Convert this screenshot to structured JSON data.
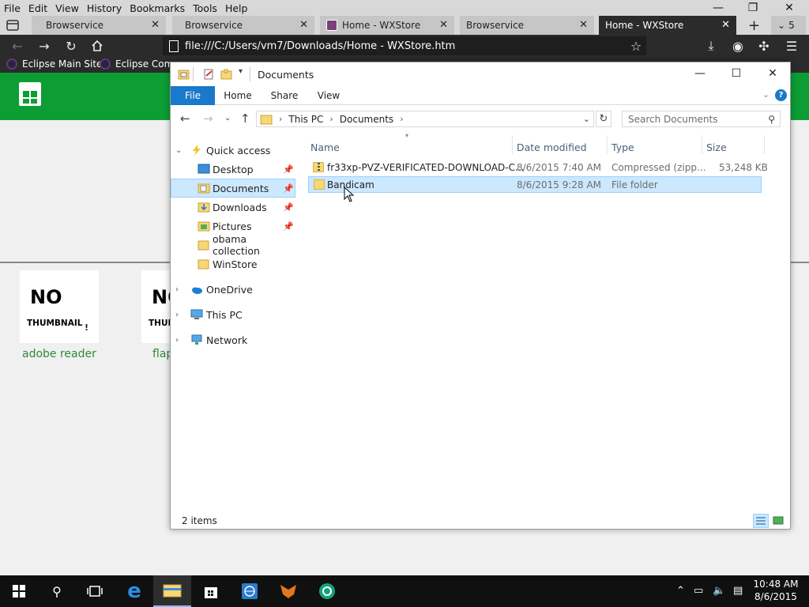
{
  "browser": {
    "menu": [
      "File",
      "Edit",
      "View",
      "History",
      "Bookmarks",
      "Tools",
      "Help"
    ],
    "tabs": [
      {
        "label": "Browservice",
        "active": false
      },
      {
        "label": "Browservice",
        "active": false
      },
      {
        "label": "Home - WXStore",
        "active": false
      },
      {
        "label": "Browservice",
        "active": false
      },
      {
        "label": "Home - WXStore",
        "active": true
      }
    ],
    "tab_count": "5",
    "url": "file:///C:/Users/vm7/Downloads/Home - WXStore.htm",
    "bookmarks": [
      "Eclipse Main Site",
      "Eclipse Comm"
    ]
  },
  "page": {
    "thumbnails": [
      {
        "big": "NO",
        "small": "THUMBNAIL",
        "excl": "!",
        "label": "adobe reader"
      },
      {
        "big": "NO",
        "small": "THUMBNAIL",
        "excl": "!",
        "label": "flappy"
      }
    ]
  },
  "explorer": {
    "title": "Documents",
    "ribbon_tabs": [
      "File",
      "Home",
      "Share",
      "View"
    ],
    "breadcrumb": [
      "This PC",
      "Documents"
    ],
    "search_placeholder": "Search Documents",
    "nav": {
      "quick_access": "Quick access",
      "pinned": [
        "Desktop",
        "Documents",
        "Downloads",
        "Pictures"
      ],
      "folders": [
        "obama collection",
        "WinStore"
      ],
      "roots": [
        "OneDrive",
        "This PC",
        "Network"
      ]
    },
    "columns": [
      "Name",
      "Date modified",
      "Type",
      "Size"
    ],
    "files": [
      {
        "name": "fr33xp-PVZ-VERIFICATED-DOWNLOAD-C...",
        "date": "8/6/2015 7:40 AM",
        "type": "Compressed (zipp...",
        "size": "53,248 KB",
        "icon": "zip-folder-icon"
      },
      {
        "name": "Bandicam",
        "date": "8/6/2015 9:28 AM",
        "type": "File folder",
        "size": "",
        "icon": "folder-icon"
      }
    ],
    "status": "2 items"
  },
  "taskbar": {
    "time": "10:48 AM",
    "date": "8/6/2015"
  },
  "colors": {
    "store_green": "#0c9e35",
    "file_tab_blue": "#1979ca",
    "selection": "#cce8ff"
  }
}
